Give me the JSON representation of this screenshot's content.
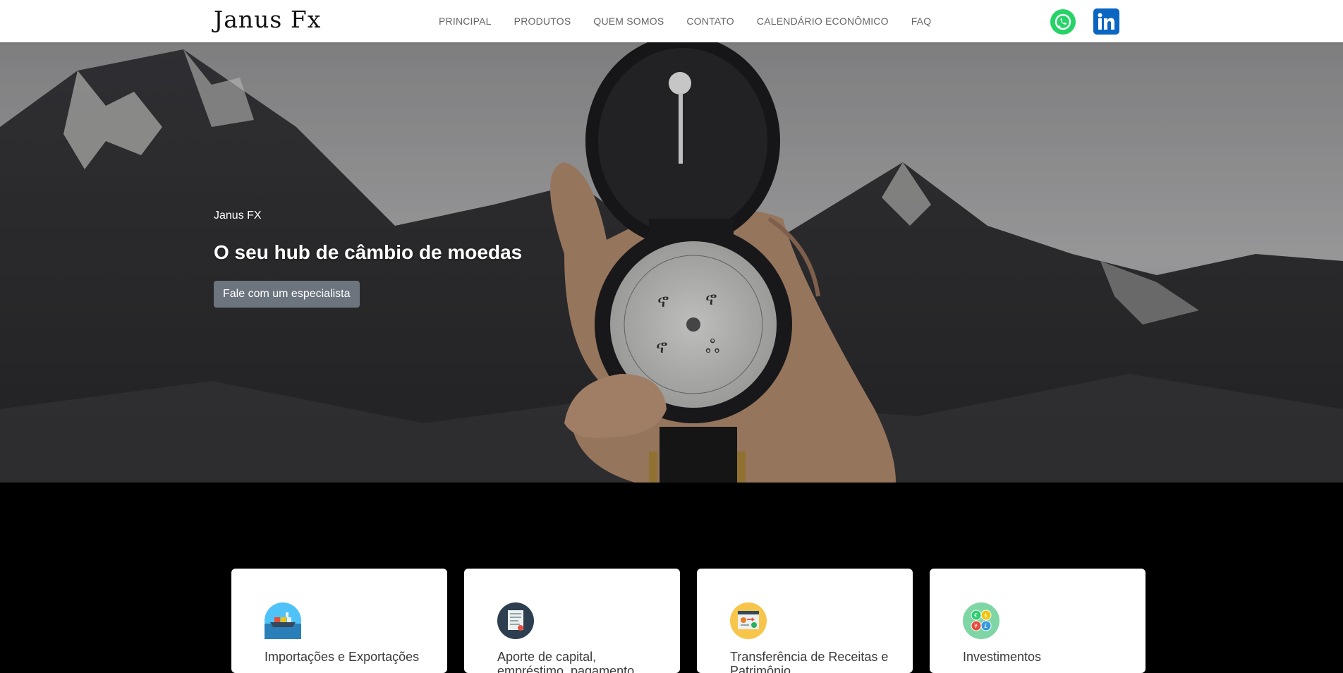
{
  "header": {
    "logo": "Janus Fx",
    "nav": [
      "PRINCIPAL",
      "PRODUTOS",
      "QUEM SOMOS",
      "CONTATO",
      "CALENDÁRIO ECONÔMICO",
      "FAQ"
    ],
    "social": [
      "whatsapp-icon",
      "linkedin-icon"
    ]
  },
  "hero": {
    "kicker": "Janus FX",
    "title": "O seu hub de câmbio de moedas",
    "cta": "Fale com um especialista"
  },
  "cards": [
    {
      "icon": "ship-icon",
      "title": "Importações e Exportações"
    },
    {
      "icon": "document-icon",
      "title": "Aporte de capital, empréstimo, pagamento"
    },
    {
      "icon": "transfer-icon",
      "title": "Transferência de Receitas e Patrimônio"
    },
    {
      "icon": "currencies-icon",
      "title": "Investimentos"
    }
  ],
  "colors": {
    "whatsapp": "#25d366",
    "linkedin": "#0a66c2",
    "cta_button": "#6c757d",
    "section_background": "#000000"
  }
}
